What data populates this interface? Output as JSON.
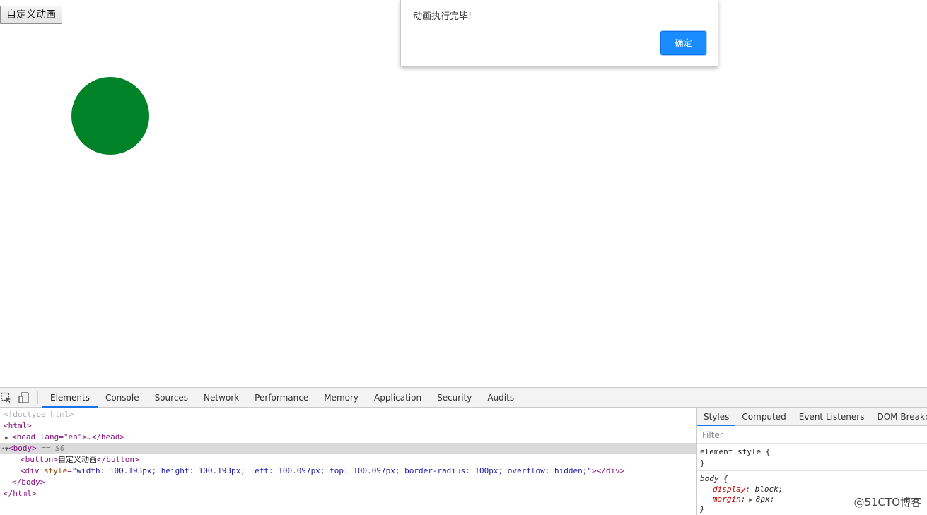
{
  "page": {
    "button_label": "自定义动画",
    "circle_color": "#008229"
  },
  "alert": {
    "message": "动画执行完毕!",
    "ok_label": "确定"
  },
  "devtools": {
    "tabs": [
      "Elements",
      "Console",
      "Sources",
      "Network",
      "Performance",
      "Memory",
      "Application",
      "Security",
      "Audits"
    ],
    "active_tab": "Elements",
    "dom": {
      "doctype": "<!doctype html>",
      "html_open": "<html>",
      "head_line": "<head lang=\"en\">…</head>",
      "body_open": "<body>",
      "body_selected_marker": "== $0",
      "button_tag_open": "<button>",
      "button_text": "自定义动画",
      "button_tag_close": "</button>",
      "div_tag_name": "<div ",
      "div_attr_name": "style",
      "div_attr_value": "\"width: 100.193px; height: 100.193px; left: 100.097px; top: 100.097px; border-radius: 100px; overflow: hidden;\"",
      "div_close": "></div>",
      "body_close": "</body>",
      "html_close": "</html>"
    },
    "styles": {
      "tabs": [
        "Styles",
        "Computed",
        "Event Listeners",
        "DOM Breakpoints"
      ],
      "active_tab": "Styles",
      "filter_placeholder": "Filter",
      "rules": {
        "element_style_selector": "element.style {",
        "element_style_close": "}",
        "body_selector": "body {",
        "body_prop1_name": "display",
        "body_prop1_value": "block;",
        "body_prop2_name": "margin",
        "body_prop2_value": "8px;",
        "body_close": "}"
      }
    }
  },
  "watermark": "@51CTO博客"
}
